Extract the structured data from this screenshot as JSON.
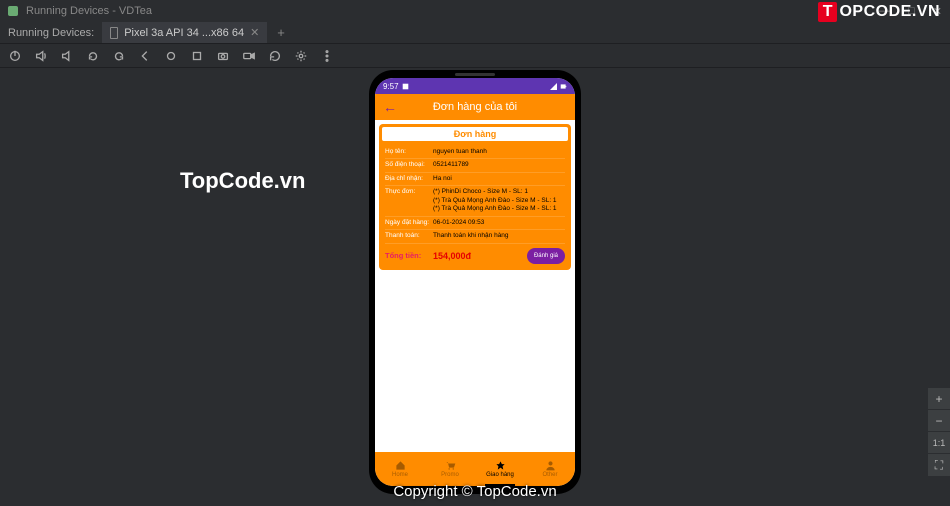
{
  "window": {
    "title": "Running Devices - VDTea"
  },
  "tabbar": {
    "label": "Running Devices:",
    "tab_text": "Pixel 3a API 34 ...x86 64"
  },
  "watermarks": {
    "left": "TopCode.vn",
    "bottom": "Copyright © TopCode.vn",
    "logo_box": "T",
    "logo_rest": "OPCODE.VN"
  },
  "phone": {
    "status_time": "9:57",
    "header_title": "Đơn hàng của tôi",
    "card_title": "Đơn hàng",
    "rows": {
      "name_k": "Họ tên:",
      "name_v": "nguyen tuan thanh",
      "phone_k": "Số điện thoại:",
      "phone_v": "0521411789",
      "addr_k": "Địa chỉ nhận:",
      "addr_v": "Ha noi",
      "menu_k": "Thực đơn:",
      "menu_v": "(*) PhinDi Choco - Size M - SL: 1\n(*) Trà Quả Mọng Anh Đào - Size M - SL: 1\n(*) Trà Quả Mọng Anh Đào - Size M - SL: 1",
      "date_k": "Ngày đặt hàng:",
      "date_v": "06-01-2024 09:53",
      "pay_k": "Thanh toán:",
      "pay_v": "Thanh toán khi nhận hàng",
      "total_k": "Tổng tiền:",
      "total_v": "154,000đ"
    },
    "btn_review": "Đánh giá",
    "nav": {
      "home": "Home",
      "promo": "Promo",
      "delivery": "Giao hàng",
      "other": "Other"
    }
  },
  "zoom": {
    "plus": "+",
    "minus": "−",
    "fit": "1:1",
    "full": "⛶"
  }
}
